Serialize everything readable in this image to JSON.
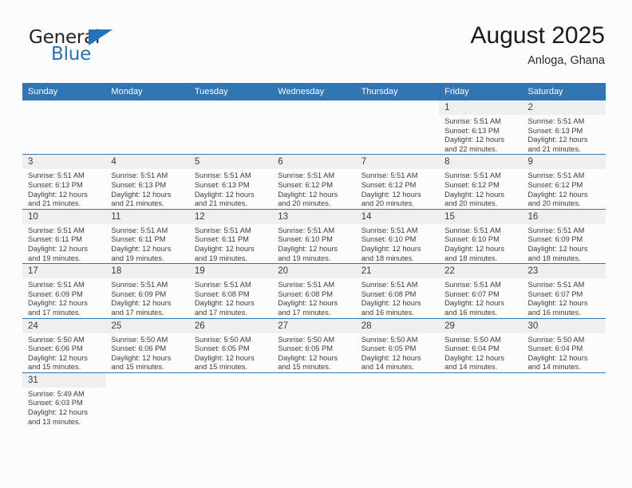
{
  "logo": {
    "word1": "General",
    "word2": "Blue",
    "triangle_color": "#1f76bc",
    "word1_color": "#221f1f",
    "word2_color": "#2175bc"
  },
  "header": {
    "title": "August 2025",
    "subtitle": "Anloga, Ghana"
  },
  "theme": {
    "header_blue": "#3075b4",
    "daynum_band": "#efefef",
    "page_background": "#fcfcfc",
    "text": "#3c3c3c"
  },
  "calendar": {
    "weekday_headers": [
      "Sunday",
      "Monday",
      "Tuesday",
      "Wednesday",
      "Thursday",
      "Friday",
      "Saturday"
    ],
    "weeks": [
      [
        {
          "day": "",
          "blank": true
        },
        {
          "day": "",
          "blank": true
        },
        {
          "day": "",
          "blank": true
        },
        {
          "day": "",
          "blank": true
        },
        {
          "day": "",
          "blank": true
        },
        {
          "day": "1",
          "sunrise": "Sunrise: 5:51 AM",
          "sunset": "Sunset: 6:13 PM",
          "daylight1": "Daylight: 12 hours",
          "daylight2": "and 22 minutes."
        },
        {
          "day": "2",
          "sunrise": "Sunrise: 5:51 AM",
          "sunset": "Sunset: 6:13 PM",
          "daylight1": "Daylight: 12 hours",
          "daylight2": "and 21 minutes."
        }
      ],
      [
        {
          "day": "3",
          "sunrise": "Sunrise: 5:51 AM",
          "sunset": "Sunset: 6:13 PM",
          "daylight1": "Daylight: 12 hours",
          "daylight2": "and 21 minutes."
        },
        {
          "day": "4",
          "sunrise": "Sunrise: 5:51 AM",
          "sunset": "Sunset: 6:13 PM",
          "daylight1": "Daylight: 12 hours",
          "daylight2": "and 21 minutes."
        },
        {
          "day": "5",
          "sunrise": "Sunrise: 5:51 AM",
          "sunset": "Sunset: 6:13 PM",
          "daylight1": "Daylight: 12 hours",
          "daylight2": "and 21 minutes."
        },
        {
          "day": "6",
          "sunrise": "Sunrise: 5:51 AM",
          "sunset": "Sunset: 6:12 PM",
          "daylight1": "Daylight: 12 hours",
          "daylight2": "and 20 minutes."
        },
        {
          "day": "7",
          "sunrise": "Sunrise: 5:51 AM",
          "sunset": "Sunset: 6:12 PM",
          "daylight1": "Daylight: 12 hours",
          "daylight2": "and 20 minutes."
        },
        {
          "day": "8",
          "sunrise": "Sunrise: 5:51 AM",
          "sunset": "Sunset: 6:12 PM",
          "daylight1": "Daylight: 12 hours",
          "daylight2": "and 20 minutes."
        },
        {
          "day": "9",
          "sunrise": "Sunrise: 5:51 AM",
          "sunset": "Sunset: 6:12 PM",
          "daylight1": "Daylight: 12 hours",
          "daylight2": "and 20 minutes."
        }
      ],
      [
        {
          "day": "10",
          "sunrise": "Sunrise: 5:51 AM",
          "sunset": "Sunset: 6:11 PM",
          "daylight1": "Daylight: 12 hours",
          "daylight2": "and 19 minutes."
        },
        {
          "day": "11",
          "sunrise": "Sunrise: 5:51 AM",
          "sunset": "Sunset: 6:11 PM",
          "daylight1": "Daylight: 12 hours",
          "daylight2": "and 19 minutes."
        },
        {
          "day": "12",
          "sunrise": "Sunrise: 5:51 AM",
          "sunset": "Sunset: 6:11 PM",
          "daylight1": "Daylight: 12 hours",
          "daylight2": "and 19 minutes."
        },
        {
          "day": "13",
          "sunrise": "Sunrise: 5:51 AM",
          "sunset": "Sunset: 6:10 PM",
          "daylight1": "Daylight: 12 hours",
          "daylight2": "and 19 minutes."
        },
        {
          "day": "14",
          "sunrise": "Sunrise: 5:51 AM",
          "sunset": "Sunset: 6:10 PM",
          "daylight1": "Daylight: 12 hours",
          "daylight2": "and 18 minutes."
        },
        {
          "day": "15",
          "sunrise": "Sunrise: 5:51 AM",
          "sunset": "Sunset: 6:10 PM",
          "daylight1": "Daylight: 12 hours",
          "daylight2": "and 18 minutes."
        },
        {
          "day": "16",
          "sunrise": "Sunrise: 5:51 AM",
          "sunset": "Sunset: 6:09 PM",
          "daylight1": "Daylight: 12 hours",
          "daylight2": "and 18 minutes."
        }
      ],
      [
        {
          "day": "17",
          "sunrise": "Sunrise: 5:51 AM",
          "sunset": "Sunset: 6:09 PM",
          "daylight1": "Daylight: 12 hours",
          "daylight2": "and 17 minutes."
        },
        {
          "day": "18",
          "sunrise": "Sunrise: 5:51 AM",
          "sunset": "Sunset: 6:09 PM",
          "daylight1": "Daylight: 12 hours",
          "daylight2": "and 17 minutes."
        },
        {
          "day": "19",
          "sunrise": "Sunrise: 5:51 AM",
          "sunset": "Sunset: 6:08 PM",
          "daylight1": "Daylight: 12 hours",
          "daylight2": "and 17 minutes."
        },
        {
          "day": "20",
          "sunrise": "Sunrise: 5:51 AM",
          "sunset": "Sunset: 6:08 PM",
          "daylight1": "Daylight: 12 hours",
          "daylight2": "and 17 minutes."
        },
        {
          "day": "21",
          "sunrise": "Sunrise: 5:51 AM",
          "sunset": "Sunset: 6:08 PM",
          "daylight1": "Daylight: 12 hours",
          "daylight2": "and 16 minutes."
        },
        {
          "day": "22",
          "sunrise": "Sunrise: 5:51 AM",
          "sunset": "Sunset: 6:07 PM",
          "daylight1": "Daylight: 12 hours",
          "daylight2": "and 16 minutes."
        },
        {
          "day": "23",
          "sunrise": "Sunrise: 5:51 AM",
          "sunset": "Sunset: 6:07 PM",
          "daylight1": "Daylight: 12 hours",
          "daylight2": "and 16 minutes."
        }
      ],
      [
        {
          "day": "24",
          "sunrise": "Sunrise: 5:50 AM",
          "sunset": "Sunset: 6:06 PM",
          "daylight1": "Daylight: 12 hours",
          "daylight2": "and 15 minutes."
        },
        {
          "day": "25",
          "sunrise": "Sunrise: 5:50 AM",
          "sunset": "Sunset: 6:06 PM",
          "daylight1": "Daylight: 12 hours",
          "daylight2": "and 15 minutes."
        },
        {
          "day": "26",
          "sunrise": "Sunrise: 5:50 AM",
          "sunset": "Sunset: 6:05 PM",
          "daylight1": "Daylight: 12 hours",
          "daylight2": "and 15 minutes."
        },
        {
          "day": "27",
          "sunrise": "Sunrise: 5:50 AM",
          "sunset": "Sunset: 6:05 PM",
          "daylight1": "Daylight: 12 hours",
          "daylight2": "and 15 minutes."
        },
        {
          "day": "28",
          "sunrise": "Sunrise: 5:50 AM",
          "sunset": "Sunset: 6:05 PM",
          "daylight1": "Daylight: 12 hours",
          "daylight2": "and 14 minutes."
        },
        {
          "day": "29",
          "sunrise": "Sunrise: 5:50 AM",
          "sunset": "Sunset: 6:04 PM",
          "daylight1": "Daylight: 12 hours",
          "daylight2": "and 14 minutes."
        },
        {
          "day": "30",
          "sunrise": "Sunrise: 5:50 AM",
          "sunset": "Sunset: 6:04 PM",
          "daylight1": "Daylight: 12 hours",
          "daylight2": "and 14 minutes."
        }
      ],
      [
        {
          "day": "31",
          "sunrise": "Sunrise: 5:49 AM",
          "sunset": "Sunset: 6:03 PM",
          "daylight1": "Daylight: 12 hours",
          "daylight2": "and 13 minutes."
        },
        {
          "day": "",
          "blank": true
        },
        {
          "day": "",
          "blank": true
        },
        {
          "day": "",
          "blank": true
        },
        {
          "day": "",
          "blank": true
        },
        {
          "day": "",
          "blank": true
        },
        {
          "day": "",
          "blank": true
        }
      ]
    ]
  }
}
